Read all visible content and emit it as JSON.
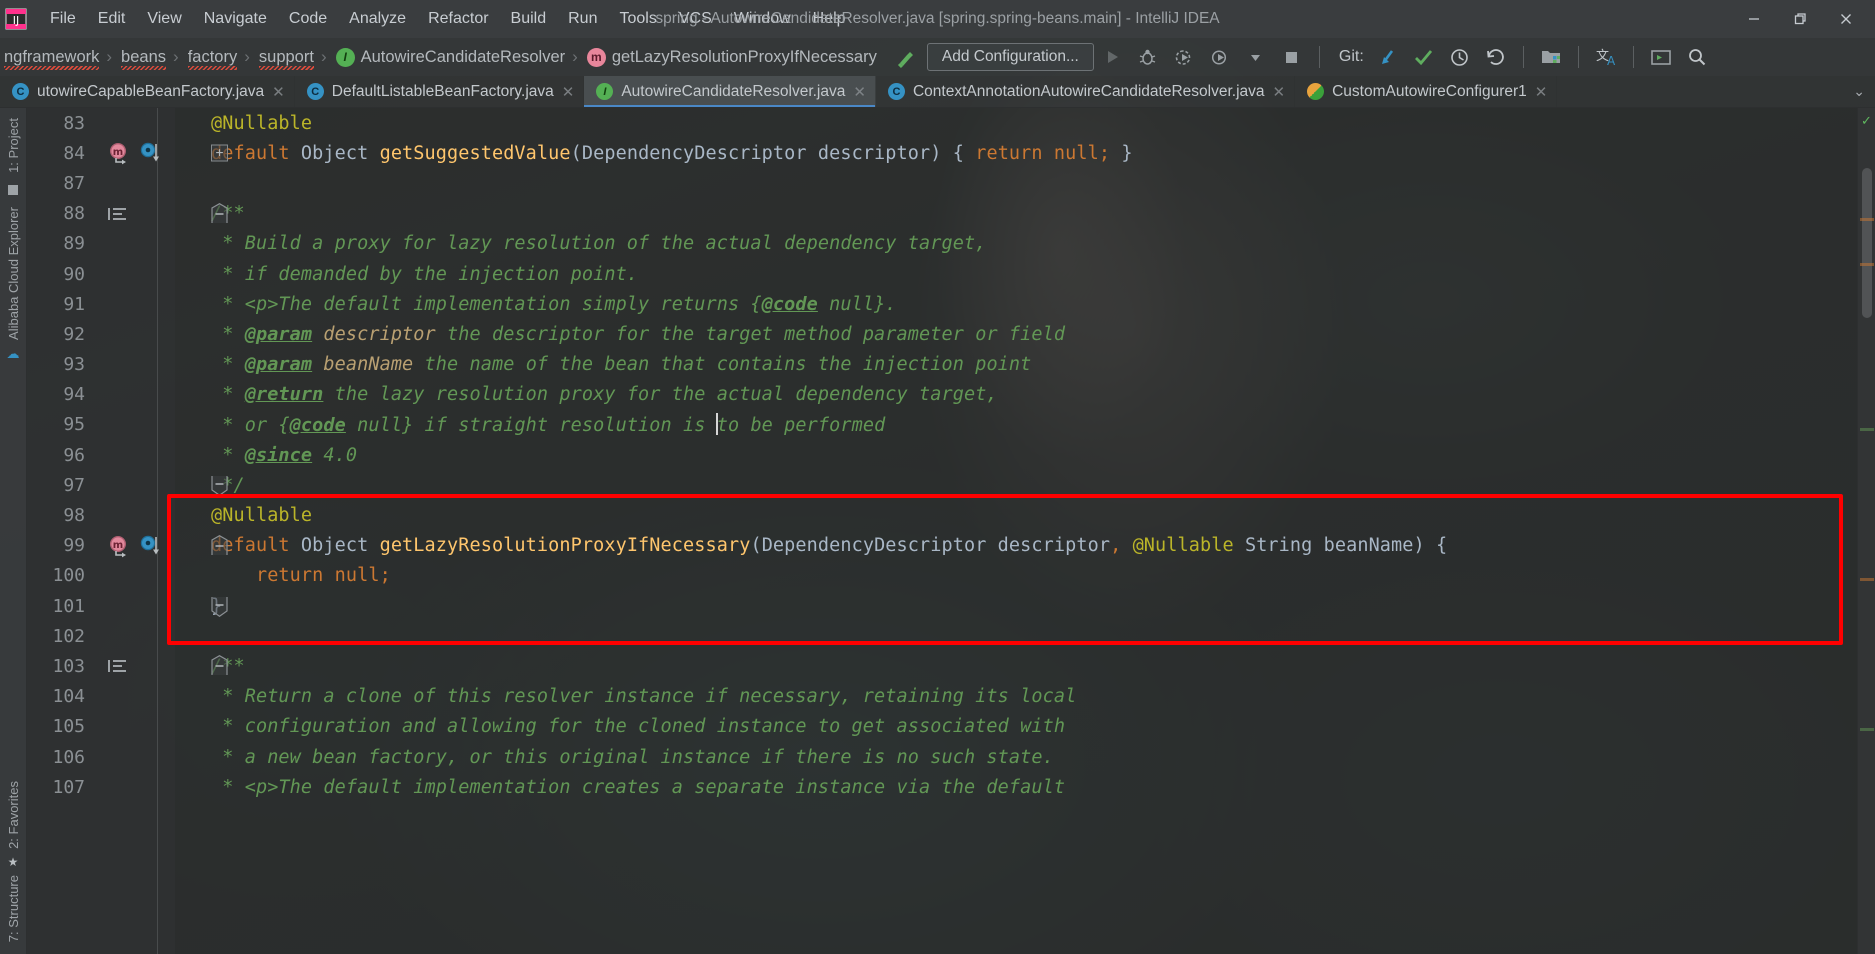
{
  "window": {
    "title": "spring - AutowireCandidateResolver.java [spring.spring-beans.main] - IntelliJ IDEA",
    "minimize": "─",
    "maximize": "❐",
    "close": "✕"
  },
  "menu": {
    "items": [
      {
        "label": "File"
      },
      {
        "label": "Edit"
      },
      {
        "label": "View"
      },
      {
        "label": "Navigate"
      },
      {
        "label": "Code"
      },
      {
        "label": "Analyze"
      },
      {
        "label": "Refactor"
      },
      {
        "label": "Build"
      },
      {
        "label": "Run"
      },
      {
        "label": "Tools"
      },
      {
        "label": "VCS"
      },
      {
        "label": "Window"
      },
      {
        "label": "Help"
      }
    ]
  },
  "navbar": {
    "crumbs": [
      {
        "label": "ngframework",
        "icon": "",
        "squiggly": true
      },
      {
        "label": "beans",
        "icon": "",
        "squiggly": true
      },
      {
        "label": "factory",
        "icon": "",
        "squiggly": true
      },
      {
        "label": "support",
        "icon": "",
        "squiggly": true
      },
      {
        "label": "AutowireCandidateResolver",
        "icon": "interface-icon",
        "icon_glyph": "I",
        "squiggly": false
      },
      {
        "label": "getLazyResolutionProxyIfNecessary",
        "icon": "method-icon",
        "icon_glyph": "m",
        "squiggly": false
      }
    ],
    "separator": "›",
    "add_configuration": "Add Configuration...",
    "git_label": "Git:",
    "icons": {
      "build_hammer": "hammer-icon",
      "run": "run-icon",
      "debug": "debug-icon",
      "run_coverage": "run-with-coverage-icon",
      "profiler": "profiler-icon",
      "dropdown": "chevron-down-icon",
      "stop": "stop-icon",
      "git_update": "git-update-icon",
      "git_commit": "git-commit-icon",
      "git_history": "git-history-icon",
      "git_rollback": "git-rollback-icon",
      "open_folder": "open-project-icon",
      "translate": "translate-icon",
      "terminal": "terminal-icon",
      "search": "search-icon"
    }
  },
  "tabs": {
    "items": [
      {
        "label": "utowireCapableBeanFactory.java",
        "icon": "class-icon",
        "glyph": "C",
        "active": false,
        "closable": true
      },
      {
        "label": "DefaultListableBeanFactory.java",
        "icon": "class-icon",
        "glyph": "C",
        "active": false,
        "closable": true
      },
      {
        "label": "AutowireCandidateResolver.java",
        "icon": "interface-icon",
        "glyph": "I",
        "active": true,
        "closable": true
      },
      {
        "label": "ContextAnnotationAutowireCandidateResolver.java",
        "icon": "class-icon",
        "glyph": "C",
        "active": false,
        "closable": true
      },
      {
        "label": "CustomAutowireConfigurer1",
        "icon": "config-icon",
        "glyph": "",
        "active": false,
        "closable": true
      }
    ],
    "close_glyph": "✕",
    "more_glyph": "⌄"
  },
  "sidebar": {
    "top_items": [
      {
        "label": "1: Project"
      }
    ],
    "mid_items": [
      {
        "label": "Alibaba Cloud Explorer"
      }
    ],
    "bottom_items": [
      {
        "label": "2: Favorites"
      },
      {
        "label": "7: Structure"
      }
    ]
  },
  "editor": {
    "file": "AutowireCandidateResolver.java",
    "annotation_box_color": "#ff0000",
    "lines": [
      {
        "number": "83",
        "gutter": [],
        "fold": "",
        "tokens": [
          {
            "t": "@Nullable",
            "c": "c-anno"
          }
        ],
        "indent": 1
      },
      {
        "number": "84",
        "gutter": [
          "method-override-icon",
          "implementation-icon"
        ],
        "fold": "plus",
        "tokens": [
          {
            "t": "default ",
            "c": "c-kw"
          },
          {
            "t": "Object ",
            "c": "c-type"
          },
          {
            "t": "getSuggestedValue",
            "c": "c-method"
          },
          {
            "t": "(",
            "c": "c-plain"
          },
          {
            "t": "DependencyDescriptor descriptor",
            "c": "c-type"
          },
          {
            "t": ") { ",
            "c": "c-plain"
          },
          {
            "t": "return null;",
            "c": "c-kw"
          },
          {
            "t": " }",
            "c": "c-plain"
          }
        ],
        "indent": 1
      },
      {
        "number": "87",
        "gutter": [],
        "fold": "",
        "tokens": [],
        "indent": 1
      },
      {
        "number": "88",
        "gutter": [
          "javadoc-icon"
        ],
        "fold": "minus-top",
        "tokens": [
          {
            "t": "/**",
            "c": "c-doc"
          }
        ],
        "indent": 1
      },
      {
        "number": "89",
        "gutter": [],
        "fold": "",
        "tokens": [
          {
            "t": " * Build a proxy for lazy resolution of the actual dependency target,",
            "c": "c-doc"
          }
        ],
        "indent": 1
      },
      {
        "number": "90",
        "gutter": [],
        "fold": "",
        "tokens": [
          {
            "t": " * if demanded by the injection point.",
            "c": "c-doc"
          }
        ],
        "indent": 1
      },
      {
        "number": "91",
        "gutter": [],
        "fold": "",
        "tokens": [
          {
            "t": " * <p>The default implementation simply returns {",
            "c": "c-doc"
          },
          {
            "t": "@code",
            "c": "c-doctag"
          },
          {
            "t": " null}.",
            "c": "c-doc"
          }
        ],
        "indent": 1
      },
      {
        "number": "92",
        "gutter": [],
        "fold": "",
        "tokens": [
          {
            "t": " * ",
            "c": "c-doc"
          },
          {
            "t": "@param",
            "c": "c-doctag"
          },
          {
            "t": " descriptor",
            "c": "c-docval"
          },
          {
            "t": " the descriptor for the target method parameter or field",
            "c": "c-doc"
          }
        ],
        "indent": 1
      },
      {
        "number": "93",
        "gutter": [],
        "fold": "",
        "tokens": [
          {
            "t": " * ",
            "c": "c-doc"
          },
          {
            "t": "@param",
            "c": "c-doctag"
          },
          {
            "t": " beanName",
            "c": "c-docval"
          },
          {
            "t": " the name of the bean that contains the injection point",
            "c": "c-doc"
          }
        ],
        "indent": 1
      },
      {
        "number": "94",
        "gutter": [],
        "fold": "",
        "tokens": [
          {
            "t": " * ",
            "c": "c-doc"
          },
          {
            "t": "@return",
            "c": "c-doctag"
          },
          {
            "t": " the lazy resolution proxy for the actual dependency target,",
            "c": "c-doc"
          }
        ],
        "indent": 1
      },
      {
        "number": "95",
        "gutter": [],
        "fold": "",
        "tokens": [
          {
            "t": " * or {",
            "c": "c-doc"
          },
          {
            "t": "@code",
            "c": "c-doctag"
          },
          {
            "t": " null} if straight resolution is ",
            "c": "c-doc"
          },
          {
            "t": "CARET",
            "c": "caret"
          },
          {
            "t": "to be performed",
            "c": "c-doc"
          }
        ],
        "indent": 1
      },
      {
        "number": "96",
        "gutter": [],
        "fold": "",
        "tokens": [
          {
            "t": " * ",
            "c": "c-doc"
          },
          {
            "t": "@since",
            "c": "c-doctag"
          },
          {
            "t": " 4.0",
            "c": "c-doc"
          }
        ],
        "indent": 1
      },
      {
        "number": "97",
        "gutter": [],
        "fold": "minus-bottom",
        "tokens": [
          {
            "t": " */",
            "c": "c-doc"
          }
        ],
        "indent": 1
      },
      {
        "number": "98",
        "gutter": [],
        "fold": "",
        "tokens": [
          {
            "t": "@Nullable",
            "c": "c-anno"
          }
        ],
        "indent": 1
      },
      {
        "number": "99",
        "gutter": [
          "method-override-icon",
          "implementation-icon"
        ],
        "fold": "minus-top",
        "tokens": [
          {
            "t": "default ",
            "c": "c-kw"
          },
          {
            "t": "Object ",
            "c": "c-type"
          },
          {
            "t": "getLazyResolutionProxyIfNecessary",
            "c": "c-method"
          },
          {
            "t": "(",
            "c": "c-plain"
          },
          {
            "t": "DependencyDescriptor descriptor",
            "c": "c-type"
          },
          {
            "t": ", ",
            "c": "c-kw"
          },
          {
            "t": "@Nullable",
            "c": "c-anno"
          },
          {
            "t": " String beanName",
            "c": "c-type"
          },
          {
            "t": ") {",
            "c": "c-plain"
          }
        ],
        "indent": 1
      },
      {
        "number": "100",
        "gutter": [],
        "fold": "",
        "tokens": [
          {
            "t": "    return null;",
            "c": "c-kw"
          }
        ],
        "indent": 1
      },
      {
        "number": "101",
        "gutter": [],
        "fold": "minus-bottom",
        "tokens": [
          {
            "t": "}",
            "c": "c-plain"
          }
        ],
        "indent": 1
      },
      {
        "number": "102",
        "gutter": [],
        "fold": "",
        "tokens": [],
        "indent": 1
      },
      {
        "number": "103",
        "gutter": [
          "javadoc-icon"
        ],
        "fold": "minus-top",
        "tokens": [
          {
            "t": "/**",
            "c": "c-doc"
          }
        ],
        "indent": 1
      },
      {
        "number": "104",
        "gutter": [],
        "fold": "",
        "tokens": [
          {
            "t": " * Return a clone of this resolver instance if necessary, retaining its local",
            "c": "c-doc"
          }
        ],
        "indent": 1
      },
      {
        "number": "105",
        "gutter": [],
        "fold": "",
        "tokens": [
          {
            "t": " * configuration and allowing for the cloned instance to get associated with",
            "c": "c-doc"
          }
        ],
        "indent": 1
      },
      {
        "number": "106",
        "gutter": [],
        "fold": "",
        "tokens": [
          {
            "t": " * a new bean factory, or this original instance if there is no such state.",
            "c": "c-doc"
          }
        ],
        "indent": 1
      },
      {
        "number": "107",
        "gutter": [],
        "fold": "",
        "tokens": [
          {
            "t": " * <p>The default implementation creates a separate instance via the default",
            "c": "c-doc"
          }
        ],
        "indent": 1
      }
    ]
  }
}
